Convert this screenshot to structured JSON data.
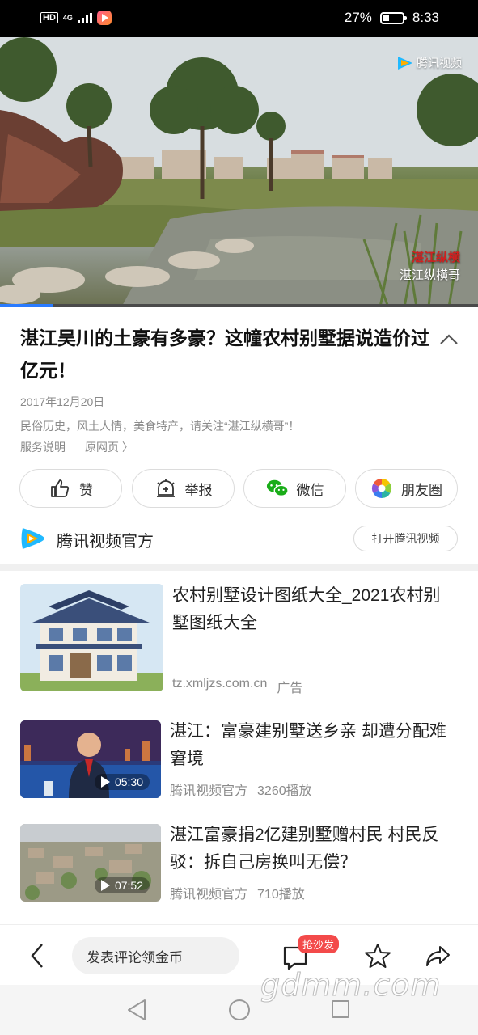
{
  "status_bar": {
    "network_hd": "HD",
    "network_4g": "4G",
    "battery": "27%",
    "time": "8:33"
  },
  "video": {
    "logo_text": "腾讯视频",
    "watermark_line1": "湛江纵横",
    "watermark_line2": "湛江纵横哥",
    "progress": 0.11
  },
  "article": {
    "title": "湛江吴川的土豪有多豪？这幢农村别墅据说造价过亿元！",
    "date": "2017年12月20日",
    "description": "民俗历史，风土人情，美食特产，请关注“湛江纵横哥”！",
    "service_link": "服务说明",
    "source_link": "原网页 〉"
  },
  "actions": {
    "like": "赞",
    "report": "举报",
    "wechat": "微信",
    "moments": "朋友圈"
  },
  "channel": {
    "name": "腾讯视频官方",
    "open_button": "打开腾讯视频"
  },
  "feed": [
    {
      "title": "农村别墅设计图纸大全_2021农村别墅图纸大全",
      "source": "tz.xmljzs.com.cn",
      "tag": "广告"
    },
    {
      "title": "湛江：富豪建别墅送乡亲 却遭分配难窘境",
      "source": "腾讯视频官方",
      "plays": "3260播放",
      "duration": "05:30"
    },
    {
      "title": "湛江富豪捐2亿建别墅赠村民 村民反驳：拆自己房换叫无偿？",
      "source": "腾讯视频官方",
      "plays": "710播放",
      "duration": "07:52"
    }
  ],
  "bottom_bar": {
    "comment_placeholder": "发表评论领金币",
    "sofa_badge": "抢沙发"
  },
  "site_watermark": "gdmm.com",
  "colors": {
    "accent_blue": "#2a7bff",
    "badge_red": "#f34a4a",
    "wechat_green": "#1aad19"
  }
}
